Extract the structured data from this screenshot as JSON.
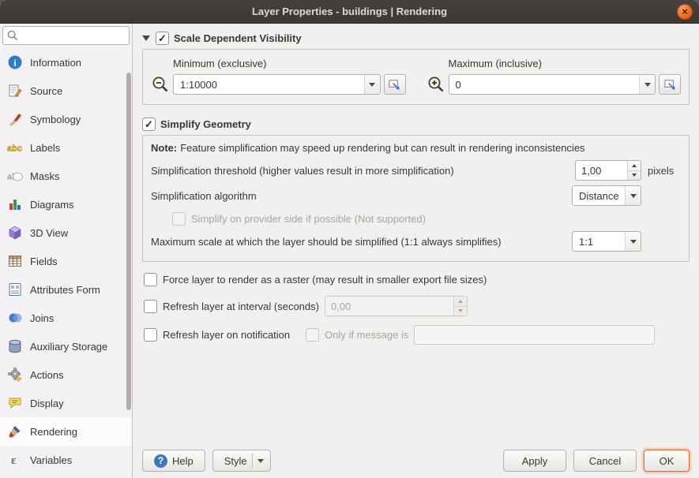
{
  "window": {
    "title": "Layer Properties - buildings | Rendering",
    "close_glyph": "×"
  },
  "sidebar": {
    "search": {
      "value": "",
      "placeholder": "",
      "icon": "search-icon"
    },
    "items": [
      {
        "label": "Information",
        "icon": "information-icon",
        "selected": false
      },
      {
        "label": "Source",
        "icon": "source-icon",
        "selected": false
      },
      {
        "label": "Symbology",
        "icon": "symbology-icon",
        "selected": false
      },
      {
        "label": "Labels",
        "icon": "labels-icon",
        "selected": false
      },
      {
        "label": "Masks",
        "icon": "masks-icon",
        "selected": false
      },
      {
        "label": "Diagrams",
        "icon": "diagrams-icon",
        "selected": false
      },
      {
        "label": "3D View",
        "icon": "three-d-view-icon",
        "selected": false
      },
      {
        "label": "Fields",
        "icon": "fields-icon",
        "selected": false
      },
      {
        "label": "Attributes Form",
        "icon": "attributes-form-icon",
        "selected": false
      },
      {
        "label": "Joins",
        "icon": "joins-icon",
        "selected": false
      },
      {
        "label": "Auxiliary Storage",
        "icon": "auxiliary-storage-icon",
        "selected": false
      },
      {
        "label": "Actions",
        "icon": "actions-icon",
        "selected": false
      },
      {
        "label": "Display",
        "icon": "display-icon",
        "selected": false
      },
      {
        "label": "Rendering",
        "icon": "rendering-icon",
        "selected": true
      },
      {
        "label": "Variables",
        "icon": "variables-icon",
        "selected": false
      }
    ]
  },
  "scale_visibility": {
    "title": "Scale Dependent Visibility",
    "checked": true,
    "minimum": {
      "label": "Minimum (exclusive)",
      "value": "1:10000",
      "icon": "zoom-out-icon",
      "set_button_icon": "set-to-canvas-scale-icon"
    },
    "maximum": {
      "label": "Maximum (inclusive)",
      "value": "0",
      "icon": "zoom-in-icon",
      "set_button_icon": "set-to-canvas-scale-icon"
    }
  },
  "simplify": {
    "title": "Simplify Geometry",
    "checked": true,
    "note_label": "Note:",
    "note_text": "Feature simplification may speed up rendering but can result in rendering inconsistencies",
    "threshold": {
      "label": "Simplification threshold (higher values result in more simplification)",
      "value": "1,00",
      "unit": "pixels"
    },
    "algorithm": {
      "label": "Simplification algorithm",
      "value": "Distance"
    },
    "provider": {
      "label": "Simplify on provider side if possible (Not supported)",
      "checked": false,
      "enabled": false
    },
    "max_scale": {
      "label": "Maximum scale at which the layer should be simplified (1:1 always simplifies)",
      "value": "1:1"
    }
  },
  "options": {
    "force_raster": {
      "label": "Force layer to render as a raster (may result in smaller export file sizes)",
      "checked": false
    },
    "refresh_interval": {
      "label": "Refresh layer at interval (seconds)",
      "checked": false,
      "value": "0,00",
      "enabled": false
    },
    "refresh_notification": {
      "label": "Refresh layer on notification",
      "checked": false
    },
    "only_if_message": {
      "label": "Only if message is",
      "checked": false,
      "enabled": false,
      "value": ""
    }
  },
  "footer": {
    "help": "Help",
    "style": "Style",
    "apply": "Apply",
    "cancel": "Cancel",
    "ok": "OK"
  },
  "colors": {
    "titlebar": "#3f3b38",
    "close_button_orange": "#ef6722",
    "focus_orange": "#dd6f33",
    "sidebar_bg": "#f3f1f4",
    "selected_item_bg": "#fcfcfc",
    "main_bg": "#f2f0ee",
    "frame_border": "#c6c1bb",
    "disabled_text": "#a9a49e"
  }
}
